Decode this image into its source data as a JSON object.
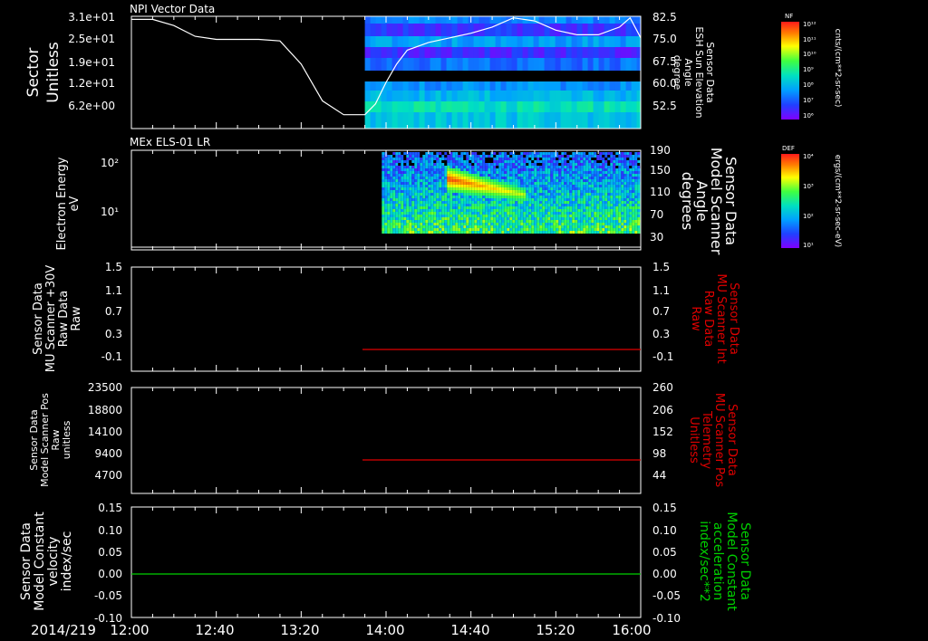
{
  "footer": {
    "date": "2014/219"
  },
  "time_axis": {
    "ticks": [
      "12:00",
      "12:40",
      "13:20",
      "14:00",
      "14:40",
      "15:20",
      "16:00"
    ]
  },
  "colors": {
    "red": "#e00000",
    "green": "#00d000",
    "white": "#ffffff",
    "background": "#000000"
  },
  "chart_data": [
    {
      "id": "npi",
      "type": "heatmap",
      "title": "NPI Vector Data",
      "ylabel": [
        "Sector",
        "Unitless"
      ],
      "yticks": [
        "3.1e+01",
        "2.5e+01",
        "1.9e+01",
        "1.2e+01",
        "6.2e+00"
      ],
      "y2label": [
        "Sensor Data",
        "ESH Sun Elevation",
        "Angle",
        "degree"
      ],
      "y2ticks": [
        "82.5",
        "75.0",
        "67.5",
        "60.0",
        "52.5"
      ],
      "y2lim": [
        46,
        82.5
      ],
      "data_start": "13:50",
      "overlay_line": {
        "color": "#ffffff",
        "x": [
          "12:00",
          "12:10",
          "12:20",
          "12:30",
          "12:40",
          "12:50",
          "13:00",
          "13:10",
          "13:20",
          "13:30",
          "13:40",
          "13:50",
          "13:55",
          "14:00",
          "14:05",
          "14:10",
          "14:20",
          "14:30",
          "14:40",
          "14:50",
          "15:00",
          "15:10",
          "15:20",
          "15:30",
          "15:40",
          "15:50",
          "15:55",
          "16:00"
        ],
        "y": [
          81.5,
          81.5,
          79.5,
          76.0,
          75.0,
          75.0,
          75.0,
          74.5,
          67.0,
          55.0,
          50.5,
          50.5,
          54.0,
          61.0,
          67.0,
          71.5,
          74.0,
          75.5,
          77.0,
          79.0,
          82.0,
          81.0,
          78.0,
          76.5,
          76.5,
          79.0,
          82.0,
          75.5
        ]
      },
      "colorbar": {
        "label": "cnts/(cm**2-sr-sec)",
        "short_label": "NF",
        "ticks": [
          "10¹²",
          "10¹¹",
          "10¹⁰",
          "10⁹",
          "10⁸",
          "10⁷",
          "10⁶"
        ]
      }
    },
    {
      "id": "els",
      "type": "heatmap",
      "title": "MEx ELS-01 LR",
      "ylabel": [
        "Electron Energy",
        "eV"
      ],
      "yticks": [
        "10²",
        "10¹"
      ],
      "y2label": [
        "Sensor Data",
        "Model Scanner",
        "Angle",
        "degrees"
      ],
      "y2ticks": [
        "190",
        "150",
        "110",
        "70",
        "30"
      ],
      "data_start": "13:58",
      "colorbar": {
        "label": "ergs/(cm**2-sr-sec-eV)",
        "short_label": "DEF",
        "ticks": [
          "10⁴",
          "10³",
          "10²",
          "10¹"
        ]
      }
    },
    {
      "id": "mu_int",
      "type": "line",
      "ylabel": [
        "Sensor Data",
        "MU Scanner +30V",
        "Raw Data",
        "Raw"
      ],
      "yticks": [
        "1.5",
        "1.1",
        "0.7",
        "0.3",
        "-0.1"
      ],
      "y2label": [
        "Sensor Data",
        "MU Scanner Int",
        "Raw Data",
        "Raw"
      ],
      "y2ticks": [
        "1.5",
        "1.1",
        "0.7",
        "0.3",
        "-0.1"
      ],
      "ylim": [
        -0.5,
        1.5
      ],
      "series": [
        {
          "color": "#e00000",
          "x": [
            "13:50",
            "16:00"
          ],
          "y": [
            0.0,
            0.0
          ]
        }
      ]
    },
    {
      "id": "mu_pos",
      "type": "line",
      "ylabel": [
        "Sensor Data",
        "Model Scanner Pos",
        "Raw",
        "unitless"
      ],
      "yticks": [
        "23500",
        "18800",
        "14100",
        "9400",
        "4700"
      ],
      "y2label": [
        "Sensor Data",
        "MU Scanner Pos",
        "Telemetry",
        "Unitless"
      ],
      "y2ticks": [
        "260",
        "206",
        "152",
        "98",
        "44"
      ],
      "y2lim": [
        -10,
        260
      ],
      "series": [
        {
          "color": "#e00000",
          "x": [
            "13:50",
            "16:00"
          ],
          "y": [
            90,
            90
          ]
        }
      ]
    },
    {
      "id": "model_const",
      "type": "line",
      "ylabel": [
        "Sensor Data",
        "Model Constant",
        "velocity",
        "index/sec"
      ],
      "yticks": [
        "0.15",
        "0.10",
        "0.05",
        "0.00",
        "-0.05",
        "-0.10"
      ],
      "y2label": [
        "Sensor Data",
        "Model Constant",
        "acceleration",
        "index/sec**2"
      ],
      "y2ticks": [
        "0.15",
        "0.10",
        "0.05",
        "0.00",
        "-0.05",
        "-0.10"
      ],
      "ylim": [
        -0.1,
        0.15
      ],
      "series": [
        {
          "color": "#00d000",
          "x": [
            "12:00",
            "16:00"
          ],
          "y": [
            0.0,
            0.0
          ]
        }
      ]
    }
  ]
}
